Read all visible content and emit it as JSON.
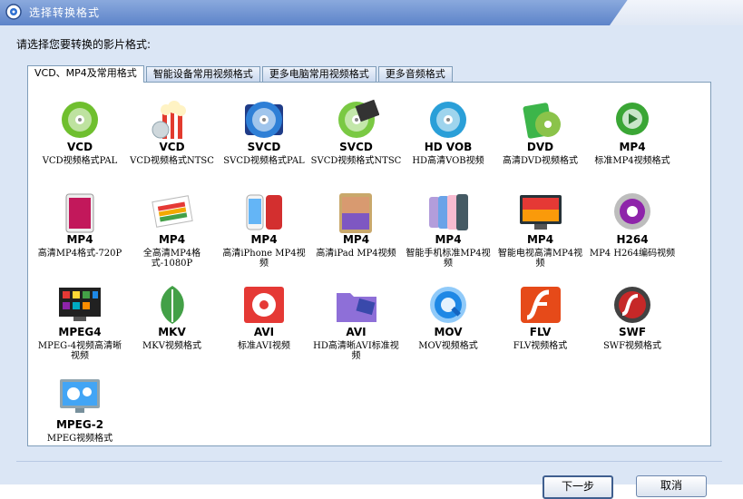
{
  "window": {
    "title": "选择转换格式"
  },
  "prompt": "请选择您要转换的影片格式:",
  "tabs": [
    {
      "label": "VCD、MP4及常用格式",
      "active": true
    },
    {
      "label": "智能设备常用视频格式",
      "active": false
    },
    {
      "label": "更多电脑常用视频格式",
      "active": false
    },
    {
      "label": "更多音频格式",
      "active": false
    }
  ],
  "formats": [
    {
      "fmt": "VCD",
      "desc": "VCD视频格式PAL",
      "icon": "vcd-disc-icon",
      "color": "#6fbf2e"
    },
    {
      "fmt": "VCD",
      "desc": "VCD视频格式NTSC",
      "icon": "popcorn-disc-icon",
      "color": "#e23b2e"
    },
    {
      "fmt": "SVCD",
      "desc": "SVCD视频格式PAL",
      "icon": "svcd-disc-icon",
      "color": "#2e7fd6"
    },
    {
      "fmt": "SVCD",
      "desc": "SVCD视频格式NTSC",
      "icon": "film-disc-icon",
      "color": "#7ac943"
    },
    {
      "fmt": "HD VOB",
      "desc": "HD高清VOB视频",
      "icon": "bluray-disc-icon",
      "color": "#2a9fd8"
    },
    {
      "fmt": "DVD",
      "desc": "高清DVD视频格式",
      "icon": "dvd-disc-icon",
      "color": "#3cb54a"
    },
    {
      "fmt": "MP4",
      "desc": "标准MP4视频格式",
      "icon": "mp4-orb-icon",
      "color": "#3aa635"
    },
    {
      "fmt": "MP4",
      "desc": "高清MP4格式-720P",
      "icon": "tablet-icon",
      "color": "#c2185b"
    },
    {
      "fmt": "MP4",
      "desc": "全高清MP4格式-1080P",
      "icon": "rainbow-screen-icon",
      "color": "#f2a900"
    },
    {
      "fmt": "MP4",
      "desc": "高清iPhone MP4视频",
      "icon": "iphone-icon",
      "color": "#d32f2f"
    },
    {
      "fmt": "MP4",
      "desc": "高清iPad MP4视频",
      "icon": "ipad-icon",
      "color": "#c9a86b"
    },
    {
      "fmt": "MP4",
      "desc": "智能手机标准MP4视频",
      "icon": "smartphones-icon",
      "color": "#6aa3e8"
    },
    {
      "fmt": "MP4",
      "desc": "智能电视高清MP4视频",
      "icon": "smart-tv-icon",
      "color": "#e53935"
    },
    {
      "fmt": "H264",
      "desc": "MP4 H264编码视频",
      "icon": "h264-orb-icon",
      "color": "#8e24aa"
    },
    {
      "fmt": "MPEG4",
      "desc": "MPEG-4视频高清晰视频",
      "icon": "tv-apps-icon",
      "color": "#1e88e5"
    },
    {
      "fmt": "MKV",
      "desc": "MKV视频格式",
      "icon": "mkv-leaf-icon",
      "color": "#43a047"
    },
    {
      "fmt": "AVI",
      "desc": "标准AVI视频",
      "icon": "avi-film-icon",
      "color": "#e53935"
    },
    {
      "fmt": "AVI",
      "desc": "HD高清晰AVI标准视频",
      "icon": "avi-folder-icon",
      "color": "#8e6fd8"
    },
    {
      "fmt": "MOV",
      "desc": "MOV视频格式",
      "icon": "quicktime-icon",
      "color": "#1e88e5"
    },
    {
      "fmt": "FLV",
      "desc": "FLV视频格式",
      "icon": "flash-icon",
      "color": "#e64a19"
    },
    {
      "fmt": "SWF",
      "desc": "SWF视频格式",
      "icon": "swf-orb-icon",
      "color": "#c62828"
    },
    {
      "fmt": "MPEG-2",
      "desc": "MPEG视频格式",
      "icon": "monitor-icon",
      "color": "#42a5f5"
    }
  ],
  "buttons": {
    "next": "下一步",
    "cancel": "取消"
  }
}
